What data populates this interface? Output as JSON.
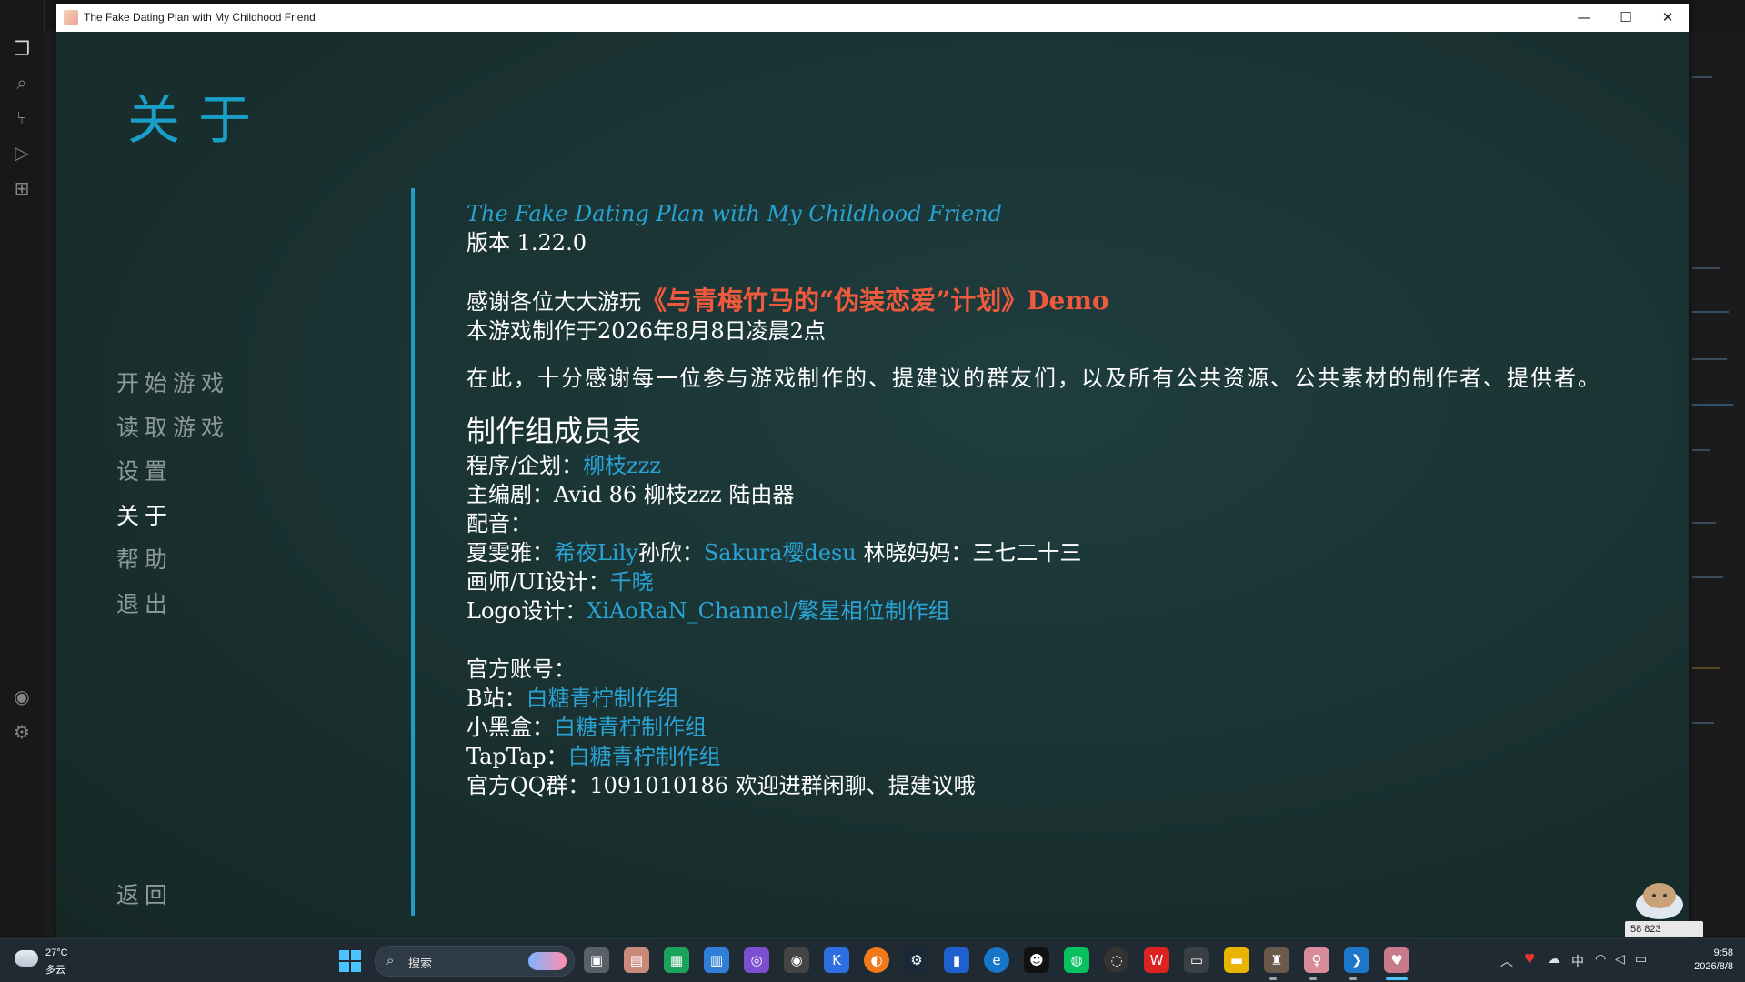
{
  "window": {
    "title": "The Fake Dating Plan with My Childhood Friend",
    "minimize_glyph": "—",
    "maximize_glyph": "☐",
    "close_glyph": "✕"
  },
  "page": {
    "heading": "关于"
  },
  "nav": {
    "items": [
      {
        "label": "开始游戏",
        "active": false
      },
      {
        "label": "读取游戏",
        "active": false
      },
      {
        "label": "设置",
        "active": false
      },
      {
        "label": "关于",
        "active": true
      },
      {
        "label": "帮助",
        "active": false
      },
      {
        "label": "退出",
        "active": false
      }
    ],
    "back_label": "返回"
  },
  "about": {
    "game_title": "The Fake Dating Plan with My Childhood Friend",
    "version": "版本 1.22.0",
    "thanks_prefix": "感谢各位大大游玩",
    "thanks_title": "《与青梅竹马的“伪装恋爱”计划》Demo",
    "made_at": "本游戏制作于2026年8月8日凌晨2点",
    "acknowledgement": "在此，十分感谢每一位参与游戏制作的、提建议的群友们，以及所有公共资源、公共素材的制作者、提供者。",
    "staff_heading": "制作组成员表",
    "program_label": "程序/企划：",
    "program_name": "柳枝zzz",
    "writer_line": "主编剧：Avid 86 柳枝zzz 陆由器",
    "voice_label": "配音：",
    "voice_role1": "夏雯雅：",
    "voice_actor1": "希夜Lily",
    "voice_role2": "孙欣：",
    "voice_actor2": "Sakura樱desu",
    "voice_role3_line": "林晓妈妈：三七二十三",
    "artist_label": "画师/UI设计：",
    "artist_name": "千晓",
    "logo_label": "Logo设计：",
    "logo_name": "XiAoRaN_Channel/繁星相位制作组",
    "accounts_heading": "官方账号：",
    "bili_label": "B站：",
    "bili_name": "白糖青柠制作组",
    "xhh_label": "小黑盒：",
    "xhh_name": "白糖青柠制作组",
    "taptap_label": "TapTap：",
    "taptap_name": "白糖青柠制作组",
    "qq_line": "官方QQ群：1091010186 欢迎进群闲聊、提建议哦"
  },
  "overlay": {
    "counter": "58 823"
  },
  "taskbar": {
    "weather_temp": "27°C",
    "weather_cond": "多云",
    "search_placeholder": "搜索",
    "tray_ime": "中",
    "time": "9:58",
    "date": "2026/8/8"
  },
  "colors": {
    "accent_blue": "#2aa3d4",
    "highlight_red": "#f05a3c",
    "game_bg": "#1a3436"
  }
}
